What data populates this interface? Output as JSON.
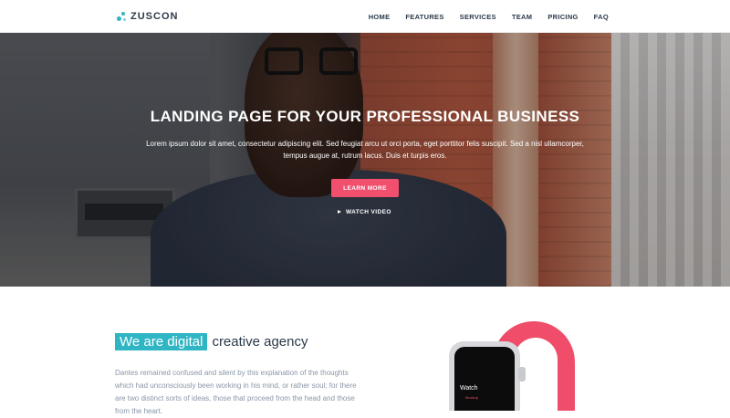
{
  "brand": {
    "name": "ZUSCON",
    "accent": "#2fb5c4"
  },
  "nav": {
    "items": [
      {
        "label": "HOME"
      },
      {
        "label": "FEATURES"
      },
      {
        "label": "SERVICES"
      },
      {
        "label": "TEAM"
      },
      {
        "label": "PRICING"
      },
      {
        "label": "FAQ"
      }
    ]
  },
  "hero": {
    "title": "LANDING PAGE FOR YOUR PROFESSIONAL BUSINESS",
    "text": "Lorem ipsum dolor sit amet, consectetur adipiscing elit. Sed feugiat arcu ut orci porta, eget porttitor felis suscipit. Sed a nisl ullamcorper, tempus augue at, rutrum lacus. Duis et turpis eros.",
    "cta_label": "LEARN MORE",
    "cta_color": "#f0506e",
    "video_label": "WATCH VIDEO"
  },
  "about": {
    "highlight": "We are digital",
    "heading_rest": "creative agency",
    "text": "Dantes remained confused and silent by this explanation of the thoughts which had unconsciously been working in his mind, or rather soul; for there are two distinct sorts of ideas, those that proceed from the head and those from the heart.",
    "watch_brand": " Watch",
    "watch_sub": "Mockup"
  }
}
